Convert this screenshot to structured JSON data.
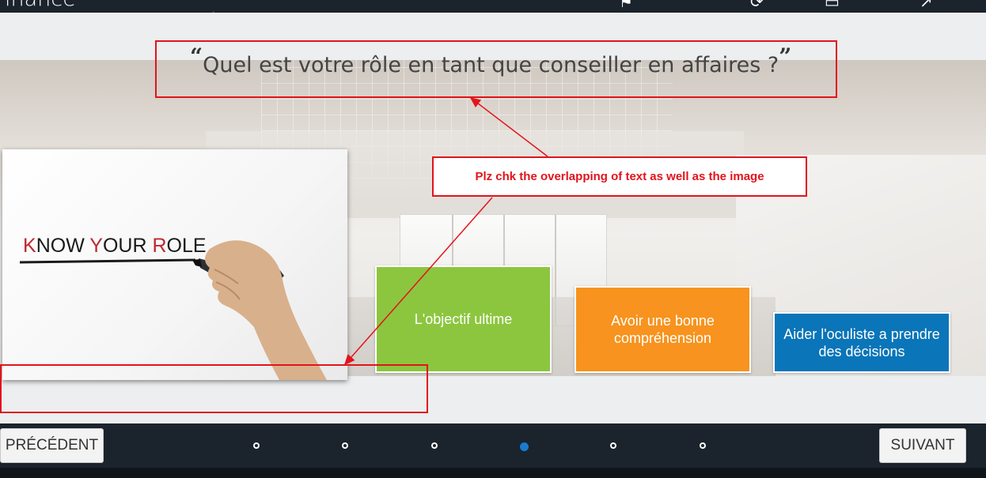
{
  "app": {
    "title": "inance"
  },
  "question": {
    "open_quote": "“",
    "text": "Quel est votre rôle en tant que conseiller en affaires ?",
    "close_quote": "”"
  },
  "annotation": {
    "note": "Plz chk the overlapping of text as well as the image",
    "color": "#e3131b"
  },
  "image": {
    "words": [
      {
        "first": "K",
        "rest": "NOW "
      },
      {
        "first": "Y",
        "rest": "OUR "
      },
      {
        "first": "R",
        "rest": "OLE"
      }
    ]
  },
  "options": [
    {
      "label": "L'objectif ultime",
      "color": "#8cc63f"
    },
    {
      "label": "Avoir une bonne compréhension",
      "color": "#f7931e"
    },
    {
      "label": "Aider l'oculiste a prendre des décisions",
      "color": "#0a75b8"
    }
  ],
  "nav": {
    "prev_label": "PRÉCÉDENT",
    "next_label": "SUIVANT",
    "page_count": 6,
    "current_page": 4,
    "active_color": "#1a7ad0"
  },
  "icons": {
    "top_bar": [
      "bookmark-icon",
      "refresh-icon",
      "document-icon",
      "settings-icon"
    ]
  }
}
